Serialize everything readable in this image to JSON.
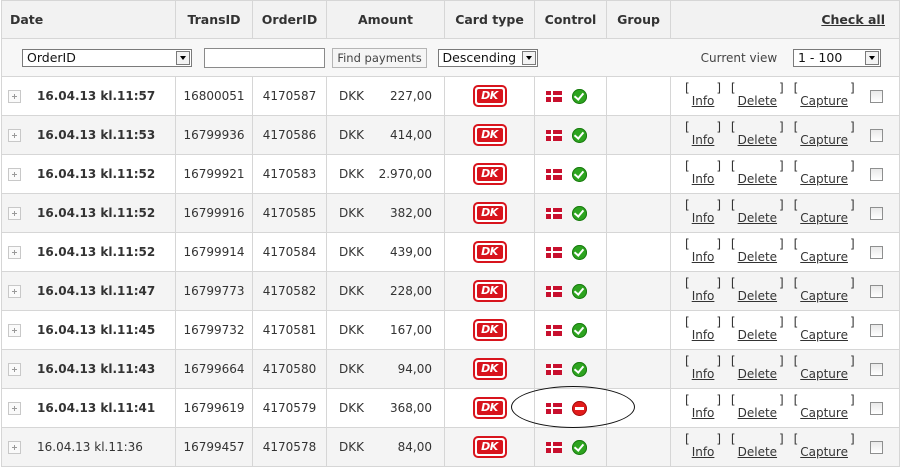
{
  "header": {
    "date": "Date",
    "transid": "TransID",
    "orderid": "OrderID",
    "amount": "Amount",
    "cardtype": "Card type",
    "control": "Control",
    "group": "Group",
    "check_all": "Check all"
  },
  "filter": {
    "field_select": "OrderID",
    "search_value": "",
    "find_button": "Find payments",
    "sort_select": "Descending",
    "current_view_label": "Current view",
    "current_view_select": "1 - 100"
  },
  "row_actions": {
    "info": "Info",
    "delete": "Delete",
    "capture": "Capture",
    "bracket_open": "[",
    "bracket_close": "]"
  },
  "card_logo_text": "DK",
  "rows": [
    {
      "date": "16.04.13 kl.11:57",
      "transid": "16800051",
      "orderid": "4170587",
      "currency": "DKK",
      "amount": "227,00",
      "card": "DK",
      "control": "ok"
    },
    {
      "date": "16.04.13 kl.11:53",
      "transid": "16799936",
      "orderid": "4170586",
      "currency": "DKK",
      "amount": "414,00",
      "card": "DK",
      "control": "ok"
    },
    {
      "date": "16.04.13 kl.11:52",
      "transid": "16799921",
      "orderid": "4170583",
      "currency": "DKK",
      "amount": "2.970,00",
      "card": "DK",
      "control": "ok"
    },
    {
      "date": "16.04.13 kl.11:52",
      "transid": "16799916",
      "orderid": "4170585",
      "currency": "DKK",
      "amount": "382,00",
      "card": "DK",
      "control": "ok"
    },
    {
      "date": "16.04.13 kl.11:52",
      "transid": "16799914",
      "orderid": "4170584",
      "currency": "DKK",
      "amount": "439,00",
      "card": "DK",
      "control": "ok"
    },
    {
      "date": "16.04.13 kl.11:47",
      "transid": "16799773",
      "orderid": "4170582",
      "currency": "DKK",
      "amount": "228,00",
      "card": "DK",
      "control": "ok"
    },
    {
      "date": "16.04.13 kl.11:45",
      "transid": "16799732",
      "orderid": "4170581",
      "currency": "DKK",
      "amount": "167,00",
      "card": "DK",
      "control": "ok"
    },
    {
      "date": "16.04.13 kl.11:43",
      "transid": "16799664",
      "orderid": "4170580",
      "currency": "DKK",
      "amount": "94,00",
      "card": "DK",
      "control": "ok"
    },
    {
      "date": "16.04.13 kl.11:41",
      "transid": "16799619",
      "orderid": "4170579",
      "currency": "DKK",
      "amount": "368,00",
      "card": "DK",
      "control": "blocked"
    },
    {
      "date": "16.04.13 kl.11:36",
      "transid": "16799457",
      "orderid": "4170578",
      "currency": "DKK",
      "amount": "84,00",
      "card": "DK",
      "control": "ok"
    }
  ],
  "colors": {
    "header_bg": "#f2f2f2",
    "alt_row_bg": "#f4f4f4",
    "border": "#d6d6d6",
    "card_red": "#d8141d",
    "ok_green": "#2da41f",
    "stop_red": "#e21b1b"
  },
  "icons": {
    "expand": "expand-plus-icon",
    "flag": "denmark-flag-icon",
    "ok": "green-check-icon",
    "blocked": "red-stop-icon"
  }
}
